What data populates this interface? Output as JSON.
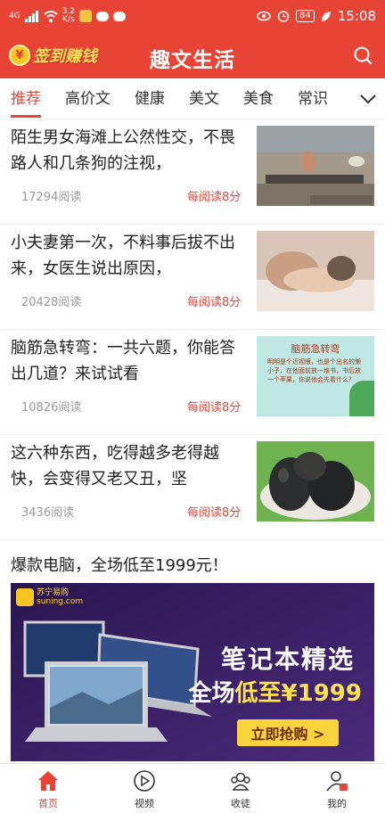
{
  "status_bar": {
    "net_top": "3.2",
    "net_bottom": "K/s",
    "signal": "4G",
    "battery": "84",
    "time": "15:08"
  },
  "header": {
    "signin_coin": "¥",
    "signin_label": "签到赚钱",
    "title": "趣文生活",
    "search_icon": "search-icon"
  },
  "tabs": [
    "推荐",
    "高价文",
    "健康",
    "美文",
    "美食",
    "常识"
  ],
  "active_tab": "推荐",
  "articles": [
    {
      "title": "陌生男女海滩上公然性交，不畏路人和几条狗的注视，",
      "reads": "17294阅读",
      "reward": "每阅读8分"
    },
    {
      "title": "小夫妻第一次，不料事后拔不出来，女医生说出原因，",
      "reads": "20428阅读",
      "reward": "每阅读8分"
    },
    {
      "title": "脑筋急转弯：一共六题，你能答出几道？来试试看",
      "reads": "10826阅读",
      "reward": "每阅读8分",
      "thumb_title": "脑筋急转弯",
      "thumb_text": "明明是个近视眼，也是个出名的懒小子，在他面前放一堆书，书后放一个苹果，你说他会先看什么？"
    },
    {
      "title": "这六种东西，吃得越多老得越快，会变得又老又丑，坚",
      "reads": "3436阅读",
      "reward": "每阅读8分"
    }
  ],
  "ad": {
    "title": "爆款电脑，全场低至1999元！",
    "logo_name": "苏宁易购",
    "logo_url": "suning.com",
    "headline": "笔记本精选",
    "sub_prefix": "全场",
    "sub_highlight": "低至¥1999",
    "cta": "立即抢购 >"
  },
  "bottom_nav": [
    {
      "label": "首页",
      "icon": "home-icon",
      "active": true
    },
    {
      "label": "视频",
      "icon": "play-icon",
      "active": false
    },
    {
      "label": "收徒",
      "icon": "apprentice-icon",
      "active": false
    },
    {
      "label": "我的",
      "icon": "profile-icon",
      "active": false
    }
  ],
  "colors": {
    "brand_red": "#e84436",
    "ad_bg": "#3b1f6b",
    "cta_yellow": "#fbd33c"
  }
}
